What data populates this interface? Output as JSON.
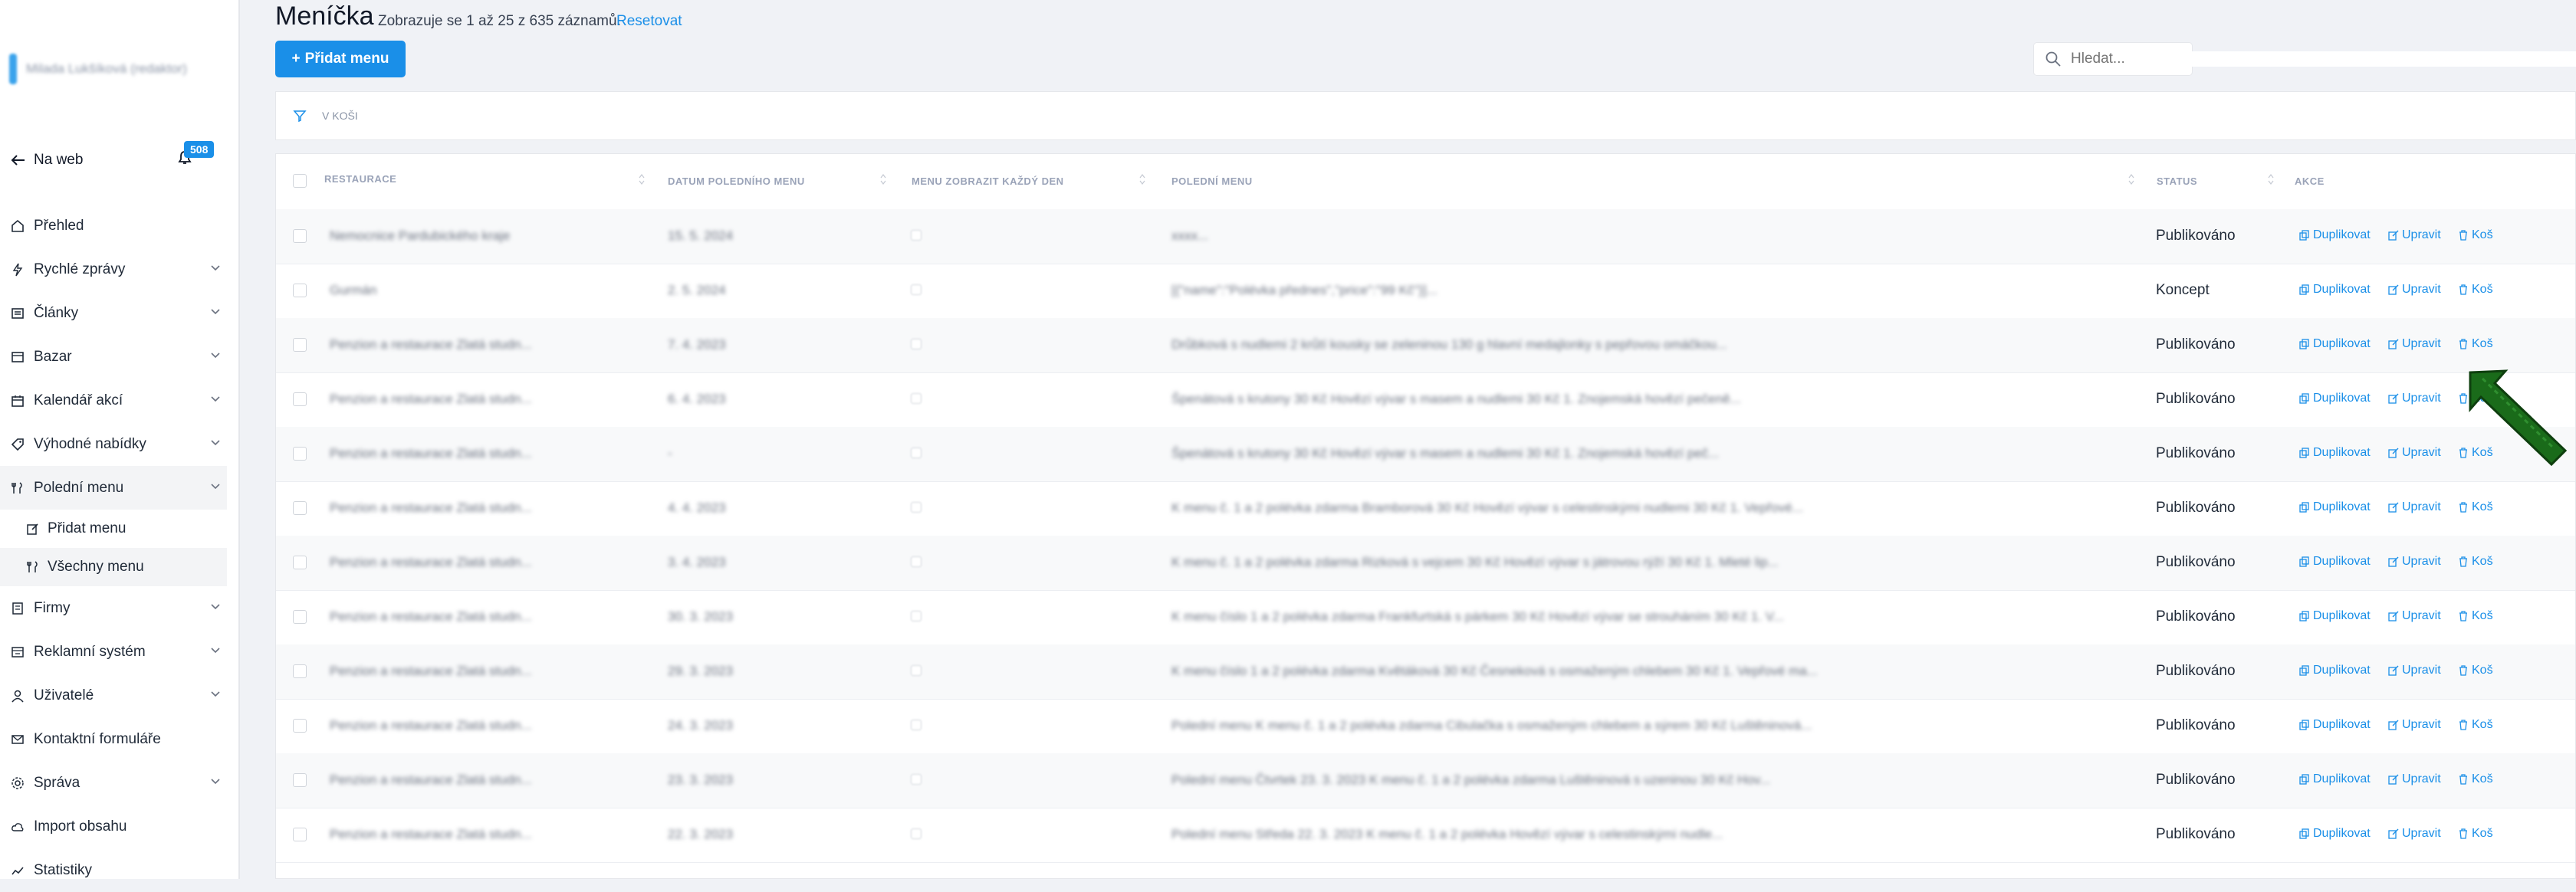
{
  "sidebar": {
    "brand_text": "Milada Lukšíková (redaktor)",
    "na_web": "Na web",
    "notifications": "508",
    "items": [
      {
        "label": "Přehled",
        "icon": "home-icon",
        "has_chevron": false
      },
      {
        "label": "Rychlé zprávy",
        "icon": "bolt-icon",
        "has_chevron": true
      },
      {
        "label": "Články",
        "icon": "articles-icon",
        "has_chevron": true
      },
      {
        "label": "Bazar",
        "icon": "bazar-icon",
        "has_chevron": true
      },
      {
        "label": "Kalendář akcí",
        "icon": "calendar-icon",
        "has_chevron": true
      },
      {
        "label": "Výhodné nabídky",
        "icon": "tag-icon",
        "has_chevron": true
      },
      {
        "label": "Polední menu",
        "icon": "cutlery-icon",
        "has_chevron": true,
        "expanded": true
      },
      {
        "label": "Firmy",
        "icon": "building-icon",
        "has_chevron": true
      },
      {
        "label": "Reklamní systém",
        "icon": "ads-icon",
        "has_chevron": true
      },
      {
        "label": "Uživatelé",
        "icon": "user-icon",
        "has_chevron": true
      },
      {
        "label": "Kontaktní formuláře",
        "icon": "mail-icon",
        "has_chevron": false
      },
      {
        "label": "Správa",
        "icon": "gear-icon",
        "has_chevron": true
      },
      {
        "label": "Import obsahu",
        "icon": "cloud-icon",
        "has_chevron": false
      },
      {
        "label": "Statistiky",
        "icon": "chart-icon",
        "has_chevron": false
      }
    ],
    "subitems": [
      {
        "label": "Přidat menu",
        "icon": "edit-icon",
        "active": false
      },
      {
        "label": "Všechny menu",
        "icon": "cutlery-icon",
        "active": true
      }
    ]
  },
  "header": {
    "title": "Meníčka",
    "subtitle": "Zobrazuje se 1 až 25 z 635 záznamů.",
    "reset": "Resetovat",
    "add_button": "Přidat menu",
    "search_placeholder": "Hledat..."
  },
  "filter": {
    "label": "V KOŠI"
  },
  "table": {
    "columns": [
      "Restaurace",
      "Datum poledního menu",
      "Menu zobrazit každý den",
      "Polední menu",
      "Status",
      "Akce"
    ],
    "actions": {
      "duplicate": "Duplikovat",
      "edit": "Upravit",
      "trash": "Koš"
    },
    "rows": [
      {
        "restaurace": "Nemocnice Pardubického kraje",
        "datum": "15. 5. 2024",
        "menu": "xxxx...",
        "status": "Publikováno"
      },
      {
        "restaurace": "Gurmán",
        "datum": "2. 5. 2024",
        "menu": "[{\"name\":\"Polévka přednes\",\"price\":\"99 Kč\"}]...",
        "status": "Koncept"
      },
      {
        "restaurace": "Penzion a restaurace Zlatá studn...",
        "datum": "7. 4. 2023",
        "menu": "Drůbková s nudlemi 2 krůtí kousky se zeleninou 130 g hlavní medajlonky s pepřovou omáčkou...",
        "status": "Publikováno"
      },
      {
        "restaurace": "Penzion a restaurace Zlatá studn...",
        "datum": "6. 4. 2023",
        "menu": "Špenátová s krutony 30 Kč Hovězí vývar s masem a nudlemi 30 Kč 1. Znojemská hovězí pečeně...",
        "status": "Publikováno"
      },
      {
        "restaurace": "Penzion a restaurace Zlatá studn...",
        "datum": "-",
        "menu": "Špenátová s krutony 30 Kč Hovězí vývar s masem a nudlemi 30 Kč 1. Znojemská hovězí peč...",
        "status": "Publikováno"
      },
      {
        "restaurace": "Penzion a restaurace Zlatá studn...",
        "datum": "4. 4. 2023",
        "menu": "K menu č. 1 a 2 polévka zdarma Bramborová 30 Kč Hovězí vývar s celestinskými nudlemi 30 Kč 1. Vepřové...",
        "status": "Publikováno"
      },
      {
        "restaurace": "Penzion a restaurace Zlatá studn...",
        "datum": "3. 4. 2023",
        "menu": "K menu č. 1 a 2 polévka zdarma Rizková s vejcem 30 Kč Hovězí vývar s játrovou rýží 30 Kč 1. Mleté lip...",
        "status": "Publikováno"
      },
      {
        "restaurace": "Penzion a restaurace Zlatá studn...",
        "datum": "30. 3. 2023",
        "menu": "K menu číslo 1 a 2 polévka zdarma Frankfurtská s párkem 30 Kč Hovězí vývar se strouháním 30 Kč 1. V...",
        "status": "Publikováno"
      },
      {
        "restaurace": "Penzion a restaurace Zlatá studn...",
        "datum": "29. 3. 2023",
        "menu": "K menu číslo 1 a 2 polévka zdarma Květáková 30 Kč Česneková s osmaženým chlebem 30 Kč 1. Vepřové ma...",
        "status": "Publikováno"
      },
      {
        "restaurace": "Penzion a restaurace Zlatá studn...",
        "datum": "24. 3. 2023",
        "menu": "Polední menu K menu č. 1 a 2 polévka zdarma Cibulačka s osmaženým chlebem a sýrem 30 Kč Luštěninová...",
        "status": "Publikováno"
      },
      {
        "restaurace": "Penzion a restaurace Zlatá studn...",
        "datum": "23. 3. 2023",
        "menu": "Polední menu Čtvrtek 23. 3. 2023 K menu č. 1 a 2 polévka zdarma Luštěninová s uzeninou 30 Kč Hov...",
        "status": "Publikováno"
      },
      {
        "restaurace": "Penzion a restaurace Zlatá studn...",
        "datum": "22. 3. 2023",
        "menu": "Polední menu Středa 22. 3. 2023 K menu č. 1 a 2 polévka Hovězí vývar s celestinskými nudle...",
        "status": "Publikováno"
      }
    ]
  }
}
